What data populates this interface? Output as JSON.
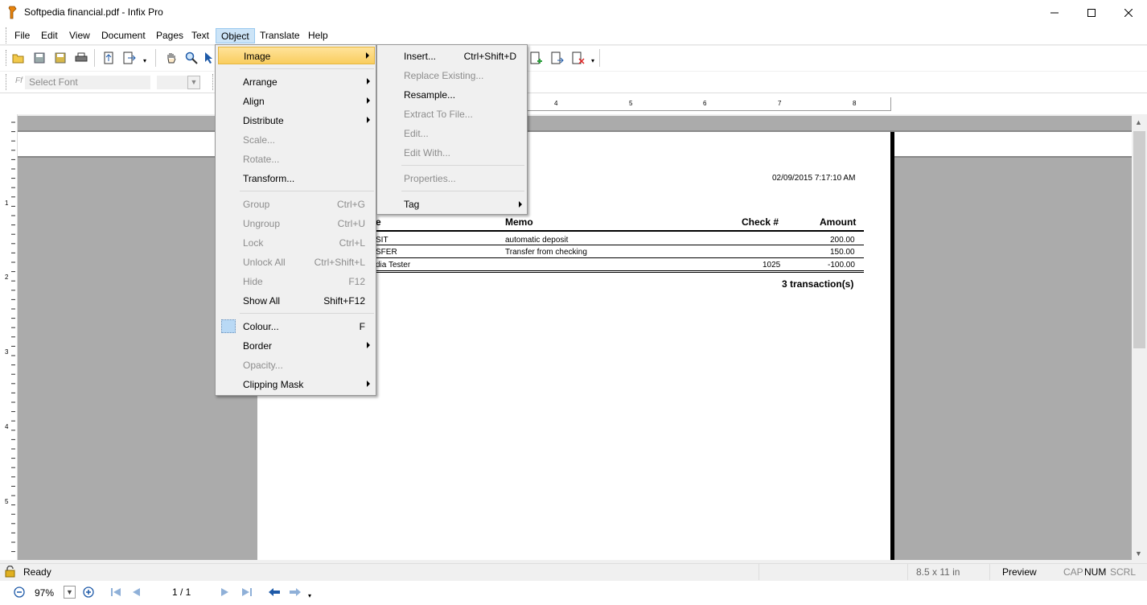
{
  "window": {
    "title": "Softpedia financial.pdf - Infix Pro"
  },
  "menubar": [
    "File",
    "Edit",
    "View",
    "Document",
    "Pages",
    "Text",
    "Object",
    "Translate",
    "Help"
  ],
  "toolbar": {
    "font_placeholder": "Select Font"
  },
  "ruler": {
    "top_numbers": [
      "4",
      "5",
      "6",
      "7",
      "8"
    ],
    "left_numbers": [
      "1",
      "2",
      "3",
      "4",
      "5"
    ]
  },
  "document": {
    "timestamp": "02/09/2015 7:17:10 AM",
    "headers": {
      "col1": "e",
      "memo": "Memo",
      "check": "Check #",
      "amount": "Amount"
    },
    "rows": [
      {
        "payee": "SIT",
        "memo": "automatic deposit",
        "check": "",
        "amount": "200.00"
      },
      {
        "payee": "SFER",
        "memo": "Transfer from checking",
        "check": "",
        "amount": "150.00"
      },
      {
        "payee": "dia Tester",
        "memo": "",
        "check": "1025",
        "amount": "-100.00"
      }
    ],
    "summary": "3 transaction(s)"
  },
  "object_menu": {
    "image": "Image",
    "arrange": "Arrange",
    "align": "Align",
    "distribute": "Distribute",
    "scale": "Scale...",
    "rotate": "Rotate...",
    "transform": "Transform...",
    "group": "Group",
    "group_sc": "Ctrl+G",
    "ungroup": "Ungroup",
    "ungroup_sc": "Ctrl+U",
    "lock": "Lock",
    "lock_sc": "Ctrl+L",
    "unlock_all": "Unlock All",
    "unlock_all_sc": "Ctrl+Shift+L",
    "hide": "Hide",
    "hide_sc": "F12",
    "show_all": "Show All",
    "show_all_sc": "Shift+F12",
    "colour": "Colour...",
    "colour_sc": "F",
    "border": "Border",
    "opacity": "Opacity...",
    "clipping_mask": "Clipping Mask"
  },
  "image_menu": {
    "insert": "Insert...",
    "insert_sc": "Ctrl+Shift+D",
    "replace": "Replace Existing...",
    "resample": "Resample...",
    "extract": "Extract To File...",
    "edit": "Edit...",
    "edit_with": "Edit With...",
    "properties": "Properties...",
    "tag": "Tag"
  },
  "status": {
    "ready": "Ready",
    "page_size": "8.5 x 11 in",
    "preview": "Preview",
    "cap": "CAP",
    "num": "NUM",
    "scrl": "SCRL"
  },
  "nav": {
    "zoom": "97%",
    "page": "1 / 1"
  },
  "colors": {
    "menu_highlight": "#f9cd5e",
    "canvas": "#ababab",
    "menu_open": "#cce4f7"
  }
}
